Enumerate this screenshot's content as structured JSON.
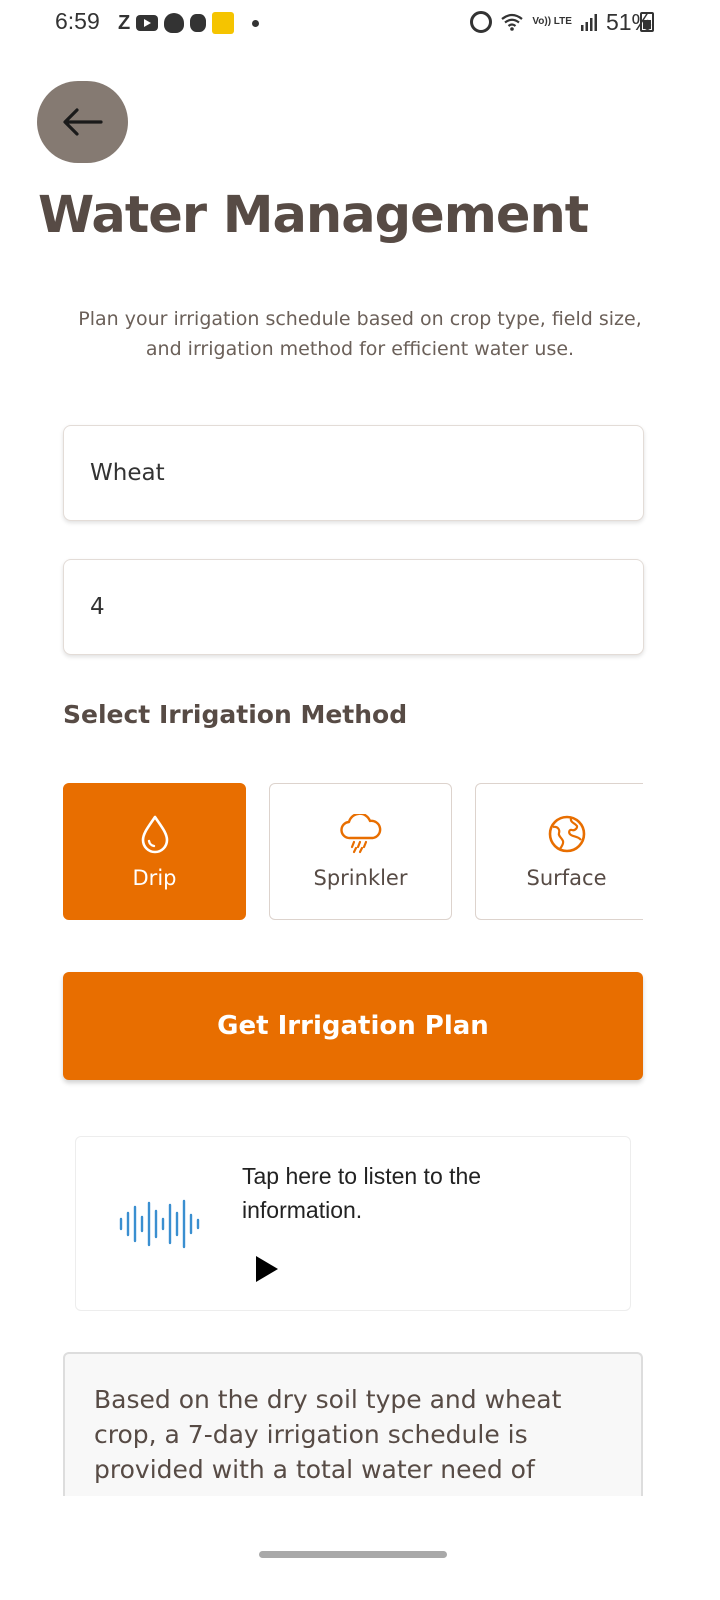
{
  "status_bar": {
    "time": "6:59",
    "battery": "51%",
    "left_icons": [
      "z-icon",
      "youtube-icon",
      "notification-icon",
      "snapchat-icon",
      "app-icon"
    ],
    "right_icons": [
      "alarm-icon",
      "wifi-icon",
      "volte-icon",
      "signal-icon",
      "battery-icon"
    ],
    "volte_label": "Vo)) LTE"
  },
  "header": {
    "back_icon": "arrow-left-icon",
    "title": "Water Management",
    "subtitle": "Plan your irrigation schedule based on crop type, field size, and irrigation method for efficient water use."
  },
  "form": {
    "crop_value": "Wheat",
    "field_size_value": "4",
    "method_section_label": "Select Irrigation Method",
    "methods": [
      {
        "label": "Drip",
        "icon": "water-drop-icon",
        "selected": true
      },
      {
        "label": "Sprinkler",
        "icon": "cloud-rain-icon",
        "selected": false
      },
      {
        "label": "Surface",
        "icon": "globe-icon",
        "selected": false
      }
    ],
    "submit_label": "Get Irrigation Plan"
  },
  "audio": {
    "prompt": "Tap here to listen to the information.",
    "wave_icon": "sound-wave-icon",
    "play_icon": "play-icon"
  },
  "result": {
    "text": "Based on the dry soil type and wheat crop, a 7-day irrigation schedule is provided with a total water need of"
  },
  "colors": {
    "accent": "#e86e00",
    "text_primary": "#574b45",
    "back_button": "#857a72",
    "wave": "#3a8fd0"
  }
}
